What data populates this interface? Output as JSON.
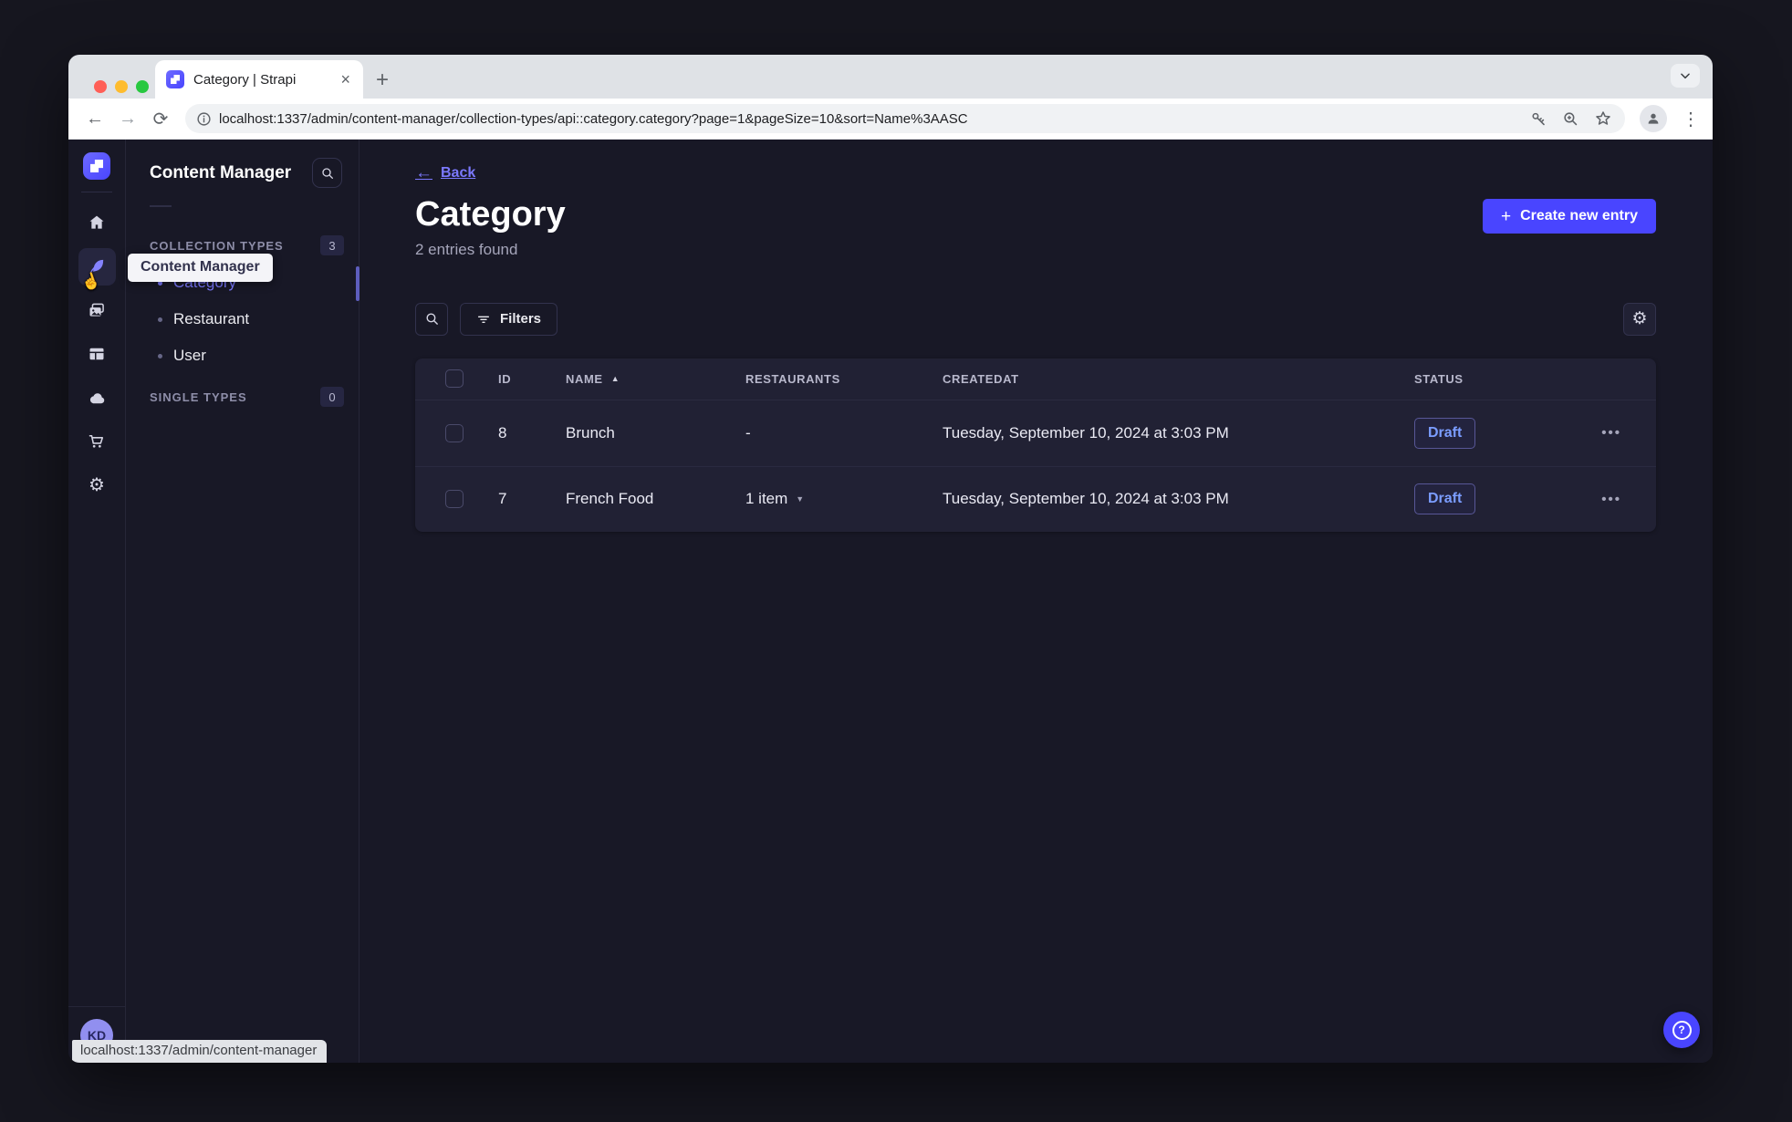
{
  "browser": {
    "tab_title": "Category | Strapi",
    "url": "localhost:1337/admin/content-manager/collection-types/api::category.category?page=1&pageSize=10&sort=Name%3AASC",
    "status_bubble": "localhost:1337/admin/content-manager"
  },
  "rail": {
    "tooltip": "Content Manager",
    "items": [
      {
        "name": "home",
        "active": false
      },
      {
        "name": "content-manager",
        "active": true
      },
      {
        "name": "media-library",
        "active": false
      },
      {
        "name": "content-type-builder",
        "active": false
      },
      {
        "name": "cloud",
        "active": false
      },
      {
        "name": "marketplace",
        "active": false
      },
      {
        "name": "settings",
        "active": false
      }
    ],
    "avatar_initials": "KD"
  },
  "subnav": {
    "title": "Content Manager",
    "collection_types": {
      "label": "COLLECTION TYPES",
      "count": "3",
      "items": [
        {
          "label": "Category",
          "active": true
        },
        {
          "label": "Restaurant",
          "active": false
        },
        {
          "label": "User",
          "active": false
        }
      ]
    },
    "single_types": {
      "label": "SINGLE TYPES",
      "count": "0"
    }
  },
  "main": {
    "back_label": "Back",
    "title": "Category",
    "subtitle": "2 entries found",
    "create_button_label": "Create new entry",
    "filters_label": "Filters",
    "table": {
      "columns": [
        "ID",
        "NAME",
        "RESTAURANTS",
        "CREATEDAT",
        "STATUS"
      ],
      "sorted_by": "NAME",
      "sort_direction": "asc",
      "rows": [
        {
          "id": "8",
          "name": "Brunch",
          "restaurants": "-",
          "created_at": "Tuesday, September 10, 2024 at 3:03 PM",
          "status": "Draft"
        },
        {
          "id": "7",
          "name": "French Food",
          "restaurants": "1 item",
          "created_at": "Tuesday, September 10, 2024 at 3:03 PM",
          "status": "Draft"
        }
      ]
    }
  },
  "colors": {
    "accent": "#4945ff",
    "accent_light": "#7b79ff",
    "page_bg": "#181826",
    "panel_bg": "#212134",
    "status_draft_text": "#7b79ff"
  }
}
